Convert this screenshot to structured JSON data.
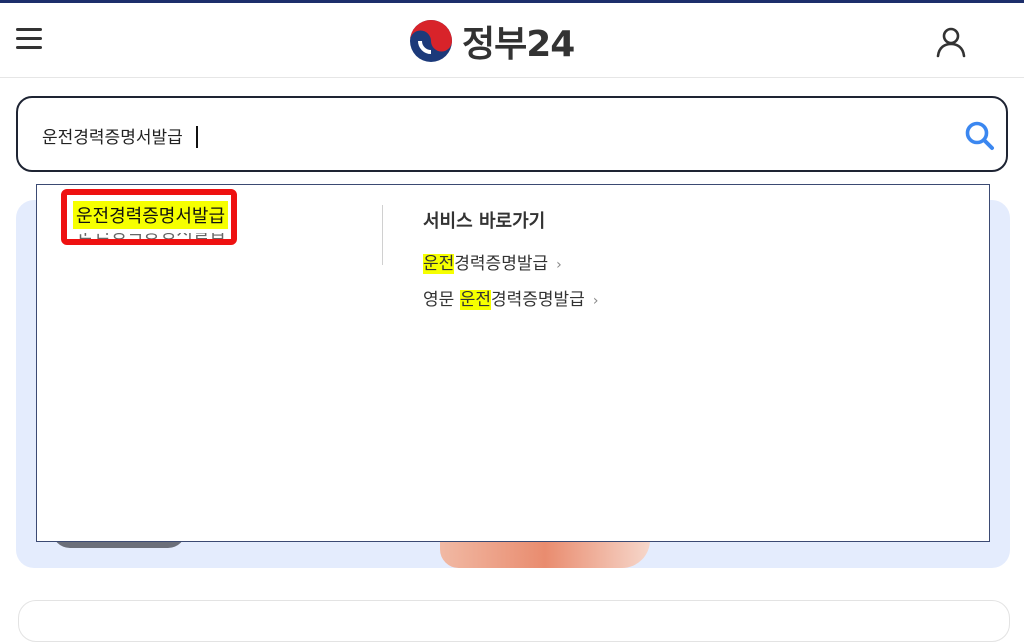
{
  "header": {
    "brand_text": "정부24",
    "brand_colors": {
      "red": "#d8232a",
      "blue": "#1c3a7a"
    },
    "menu_icon": "hamburger-icon",
    "user_icon": "user-icon"
  },
  "search": {
    "value": "운전경력증명서발급",
    "search_icon": "search-icon",
    "accent_color": "#3b87f0"
  },
  "autocomplete": {
    "suggestions": [
      {
        "highlight": "운전경력증명서발급"
      },
      {
        "text": "운전경력증명서발급"
      }
    ],
    "shortcuts_title": "서비스 바로가기",
    "shortcuts": [
      {
        "prefix": "",
        "highlight": "운전",
        "rest": "경력증명발급",
        "arrow": "›"
      },
      {
        "prefix": "영문 ",
        "highlight": "운전",
        "rest": "경력증명발급",
        "arrow": "›"
      }
    ],
    "highlight_color": "#f6ff00",
    "annotation_color": "#ee1111"
  }
}
